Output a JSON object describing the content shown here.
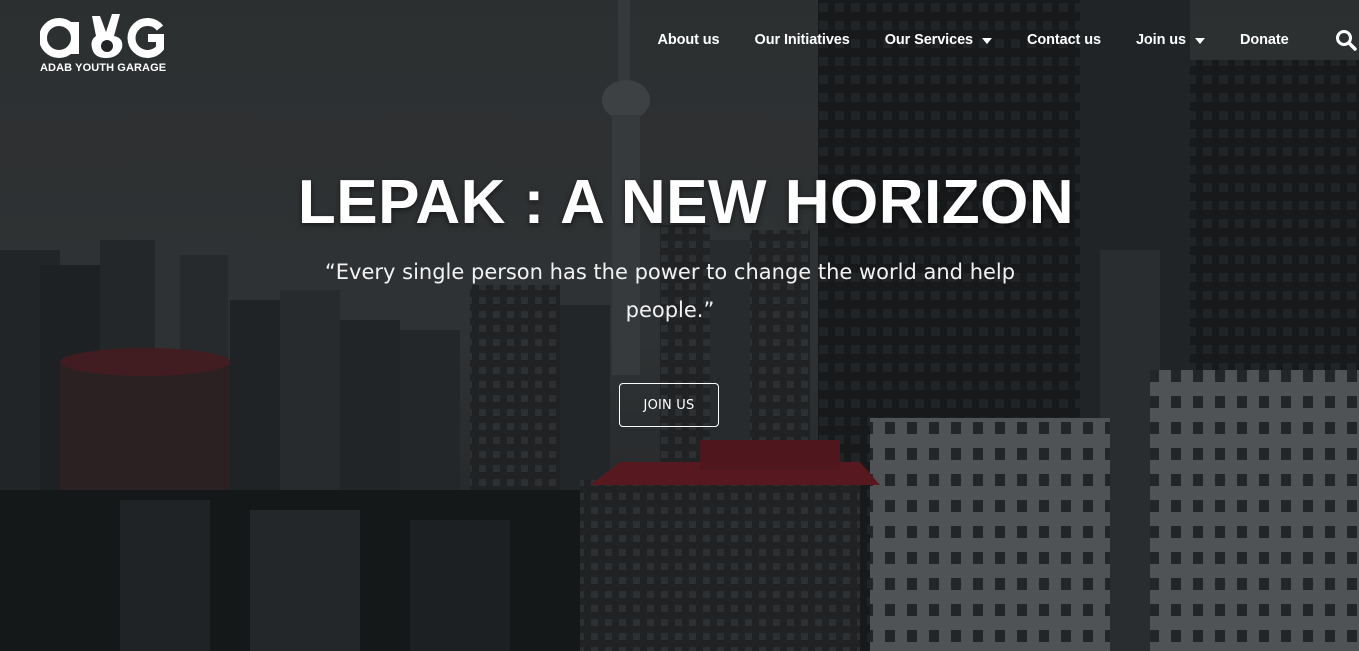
{
  "brand": {
    "name": "ADAB YOUTH GARAGE",
    "logo_icon": "ayg-peace-hand-logo"
  },
  "nav": {
    "items": [
      {
        "label": "About us",
        "has_dropdown": false
      },
      {
        "label": "Our Initiatives",
        "has_dropdown": false
      },
      {
        "label": "Our Services",
        "has_dropdown": true
      },
      {
        "label": "Contact us",
        "has_dropdown": false
      },
      {
        "label": "Join us",
        "has_dropdown": true
      },
      {
        "label": "Donate",
        "has_dropdown": false
      }
    ],
    "search_icon": "search-icon"
  },
  "hero": {
    "title": "LEPAK : A NEW HORIZON",
    "quote": "“Every single person has the power to change the world and help people.”",
    "cta_label": "JOIN US",
    "background": "city-skyline-photo"
  },
  "colors": {
    "text": "#ffffff",
    "overlay": "#0a0c0e",
    "sky": "#3a3c3e",
    "accent_roof": "#8a1f2a"
  }
}
